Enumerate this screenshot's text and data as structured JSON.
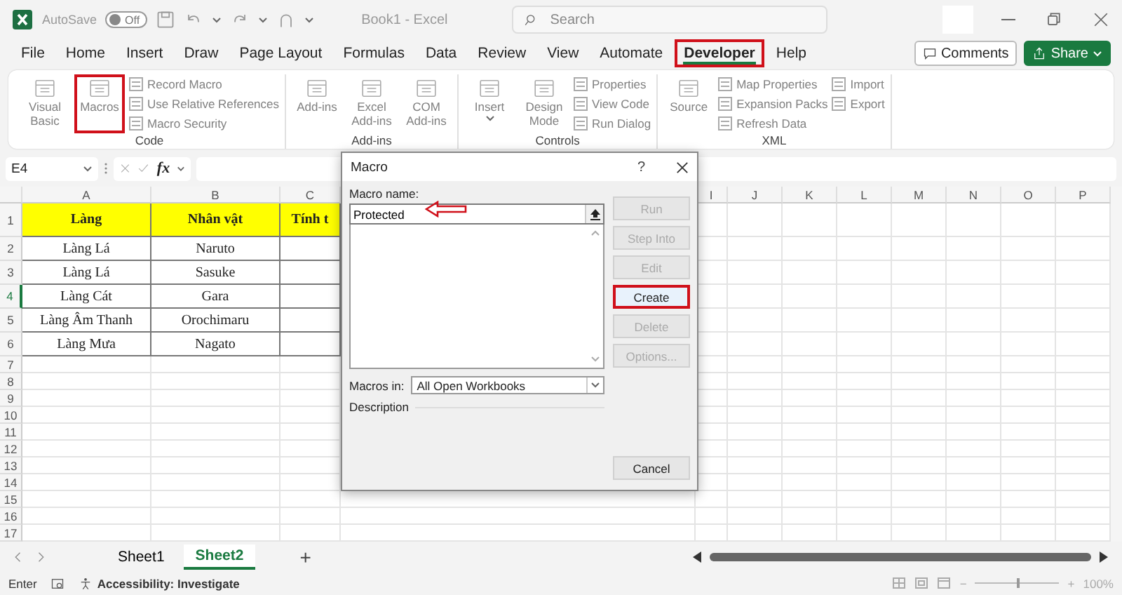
{
  "title_bar": {
    "autosave_label": "AutoSave",
    "autosave_toggle": {
      "label": "Off",
      "on": false
    },
    "document_title": "Book1  -  Excel",
    "search": {
      "placeholder": "Search"
    }
  },
  "menu_tabs": [
    {
      "label": "File",
      "selected": false,
      "highlighted": false
    },
    {
      "label": "Home",
      "selected": false,
      "highlighted": false
    },
    {
      "label": "Insert",
      "selected": false,
      "highlighted": false
    },
    {
      "label": "Draw",
      "selected": false,
      "highlighted": false
    },
    {
      "label": "Page Layout",
      "selected": false,
      "highlighted": false
    },
    {
      "label": "Formulas",
      "selected": false,
      "highlighted": false
    },
    {
      "label": "Data",
      "selected": false,
      "highlighted": false
    },
    {
      "label": "Review",
      "selected": false,
      "highlighted": false
    },
    {
      "label": "View",
      "selected": false,
      "highlighted": false
    },
    {
      "label": "Automate",
      "selected": false,
      "highlighted": false
    },
    {
      "label": "Developer",
      "selected": true,
      "highlighted": true
    },
    {
      "label": "Help",
      "selected": false,
      "highlighted": false
    }
  ],
  "header_buttons": [
    {
      "kind": "outline",
      "label": "Comments"
    },
    {
      "kind": "primary",
      "label": "Share"
    }
  ],
  "ribbon": {
    "groups": [
      {
        "label": "Code",
        "large": [
          {
            "label": "Visual Basic",
            "kind": "button",
            "highlighted": false
          },
          {
            "label": "Macros",
            "kind": "button",
            "highlighted": true
          }
        ],
        "small": [
          [
            {
              "label": "Record Macro"
            },
            {
              "label": "Use Relative References"
            },
            {
              "label": "Macro Security"
            }
          ]
        ]
      },
      {
        "label": "Add-ins",
        "large": [
          {
            "label": "Add-ins",
            "kind": "button",
            "highlighted": false
          },
          {
            "label": "Excel Add-ins",
            "kind": "button",
            "highlighted": false
          },
          {
            "label": "COM Add-ins",
            "kind": "button",
            "highlighted": false
          }
        ]
      },
      {
        "label": "Controls",
        "large": [
          {
            "label": "Insert",
            "kind": "menu",
            "highlighted": false
          },
          {
            "label": "Design Mode",
            "kind": "button",
            "highlighted": false
          }
        ],
        "small": [
          [
            {
              "label": "Properties"
            },
            {
              "label": "View Code"
            },
            {
              "label": "Run Dialog"
            }
          ]
        ]
      },
      {
        "label": "XML",
        "large": [
          {
            "label": "Source",
            "kind": "button",
            "highlighted": false
          }
        ],
        "small": [
          [
            {
              "label": "Map Properties"
            },
            {
              "label": "Expansion Packs"
            },
            {
              "label": "Refresh Data"
            }
          ],
          [
            {
              "label": "Import"
            },
            {
              "label": "Export"
            }
          ]
        ]
      }
    ]
  },
  "formula_bar": {
    "name_box": "E4",
    "function_label": "fx"
  },
  "sheet": {
    "columns": [
      {
        "label": "A"
      },
      {
        "label": "B"
      },
      {
        "label": "C"
      },
      {
        "label": "I"
      },
      {
        "label": "J"
      },
      {
        "label": "K"
      },
      {
        "label": "L"
      },
      {
        "label": "M"
      },
      {
        "label": "N"
      },
      {
        "label": "O"
      },
      {
        "label": "P"
      }
    ],
    "rows": [
      {
        "header": "1",
        "kind": "header",
        "selected": false,
        "cells": [
          "Làng",
          "Nhân vật",
          "Tính t"
        ]
      },
      {
        "header": "2",
        "kind": "data",
        "selected": false,
        "cells": [
          "Làng Lá",
          "Naruto"
        ]
      },
      {
        "header": "3",
        "kind": "data",
        "selected": false,
        "cells": [
          "Làng Lá",
          "Sasuke"
        ]
      },
      {
        "header": "4",
        "kind": "data",
        "selected": true,
        "cells": [
          "Làng Cát",
          "Gara"
        ]
      },
      {
        "header": "5",
        "kind": "data",
        "selected": false,
        "cells": [
          "Làng Âm Thanh",
          "Orochimaru"
        ]
      },
      {
        "header": "6",
        "kind": "data",
        "selected": false,
        "cells": [
          "Làng Mưa",
          "Nagato"
        ]
      },
      {
        "header": "7",
        "kind": "empty",
        "selected": false
      },
      {
        "header": "8",
        "kind": "empty",
        "selected": false
      },
      {
        "header": "9",
        "kind": "empty",
        "selected": false
      },
      {
        "header": "10",
        "kind": "empty",
        "selected": false
      },
      {
        "header": "11",
        "kind": "empty",
        "selected": false
      },
      {
        "header": "12",
        "kind": "empty",
        "selected": false
      },
      {
        "header": "13",
        "kind": "empty",
        "selected": false
      },
      {
        "header": "14",
        "kind": "empty",
        "selected": false
      },
      {
        "header": "15",
        "kind": "empty",
        "selected": false
      },
      {
        "header": "16",
        "kind": "empty",
        "selected": false
      },
      {
        "header": "17",
        "kind": "empty",
        "selected": false
      }
    ]
  },
  "sheet_tabs": [
    {
      "label": "Sheet1",
      "selected": false
    },
    {
      "label": "Sheet2",
      "selected": true
    }
  ],
  "add_sheet": "+",
  "status_bar": {
    "mode": "Enter",
    "accessibility": "Accessibility: Investigate",
    "zoom": {
      "minus": "−",
      "plus": "+",
      "label": "100%",
      "level": 0.5
    }
  },
  "dialog": {
    "title": "Macro",
    "help": "?",
    "macro_name_label": "Macro name:",
    "macro_name": {
      "value": "Protected"
    },
    "buttons": [
      {
        "label": "Run",
        "disabled": true,
        "highlighted": false
      },
      {
        "label": "Step Into",
        "disabled": true,
        "highlighted": false
      },
      {
        "label": "Edit",
        "disabled": true,
        "highlighted": false
      },
      {
        "label": "Create",
        "disabled": false,
        "highlighted": true
      },
      {
        "label": "Delete",
        "disabled": true,
        "highlighted": false
      },
      {
        "label": "Options...",
        "disabled": true,
        "highlighted": false
      }
    ],
    "macros_in_label": "Macros in:",
    "macros_in": {
      "value": "All Open Workbooks"
    },
    "description_label": "Description",
    "cancel": {
      "label": "Cancel",
      "disabled": false,
      "highlighted": false
    }
  }
}
